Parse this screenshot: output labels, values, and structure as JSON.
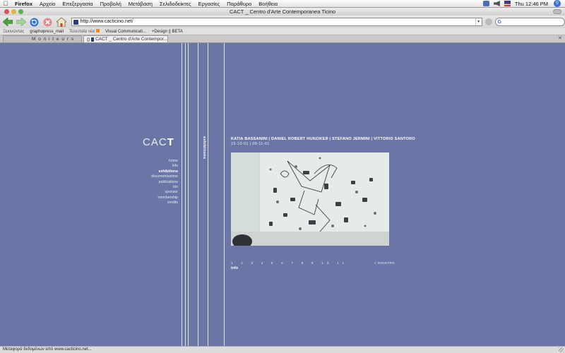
{
  "menubar": {
    "apple": "",
    "app_name": "Firefox",
    "items": [
      "Αρχείο",
      "Επεξεργασία",
      "Προβολή",
      "Μετάβαση",
      "Σελιδοδείκτες",
      "Εργασίες",
      "Παράθυρο",
      "Βοήθεια"
    ],
    "clock": "Thu 12:46 PM"
  },
  "window": {
    "title": "CACT _ Centro d'Arte Contemporanea Ticino"
  },
  "toolbar": {
    "url": "http://www.cacticino.net/",
    "search_placeholder": ""
  },
  "bookmarks": [
    "Ξεκινώντας",
    "graphopress_mail",
    "Τελευταία νέα",
    "Visual Communicati...",
    "+Design || BETA"
  ],
  "tabs": [
    {
      "label": "M o n i t e u r s",
      "active": false
    },
    {
      "label": "CACT _ Centro d'Arte Contempor...",
      "active": true
    }
  ],
  "site": {
    "logo_light": "CAC",
    "logo_bold": "T",
    "nav": [
      {
        "label": "home",
        "active": false
      },
      {
        "label": "info",
        "active": false
      },
      {
        "label": "exhibitions",
        "active": true
      },
      {
        "label": "documentazione",
        "active": false
      },
      {
        "label": "publications",
        "active": false
      },
      {
        "label": "bio",
        "active": false
      },
      {
        "label": "sponsor",
        "active": false
      },
      {
        "label": "membership",
        "active": false
      },
      {
        "label": "credits",
        "active": false
      }
    ],
    "section_label": "exhibitions",
    "artists": "KATIA BASSANINI | DANIEL ROBERT HUNZIKER | STEFANO JERMINI | VITTORIO SANTORO",
    "dates": "15-10-01 | 09-11-01",
    "pager": "1 2 3 4 5 6 7 8 9 10 11",
    "info_link": "info",
    "back_link": "< INDIETRO"
  },
  "statusbar": {
    "text": "Μεταφορά δεδομένων από www.cacticino.net..."
  },
  "colors": {
    "page_background": "#6b76a6",
    "line": "#dfe3ef"
  }
}
